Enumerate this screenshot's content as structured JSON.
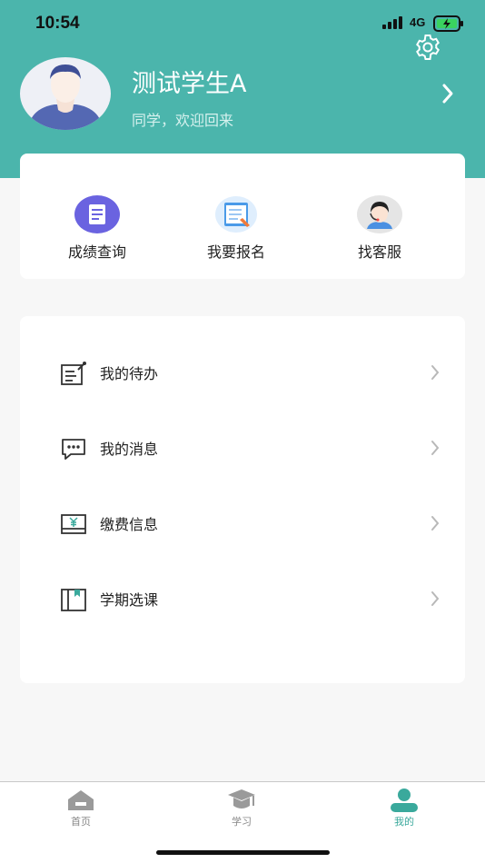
{
  "status_bar": {
    "time": "10:54",
    "network": "4G"
  },
  "profile": {
    "name": "测试学生A",
    "greeting": "同学，欢迎回来"
  },
  "quick_actions": [
    {
      "label": "成绩查询",
      "icon": "document-icon"
    },
    {
      "label": "我要报名",
      "icon": "signup-form-icon"
    },
    {
      "label": "找客服",
      "icon": "customer-service-icon"
    }
  ],
  "menu": [
    {
      "label": "我的待办",
      "icon": "todo-icon"
    },
    {
      "label": "我的消息",
      "icon": "message-icon"
    },
    {
      "label": "缴费信息",
      "icon": "payment-icon"
    },
    {
      "label": "学期选课",
      "icon": "course-book-icon"
    }
  ],
  "tabbar": {
    "active": "我的",
    "tabs": [
      {
        "label": "首页",
        "icon": "home-icon"
      },
      {
        "label": "学习",
        "icon": "graduation-cap-icon"
      },
      {
        "label": "我的",
        "icon": "person-icon"
      }
    ]
  },
  "colors": {
    "brand": "#4bb5ac",
    "active_tab": "#3aa99c",
    "background": "#f7f7f7"
  }
}
